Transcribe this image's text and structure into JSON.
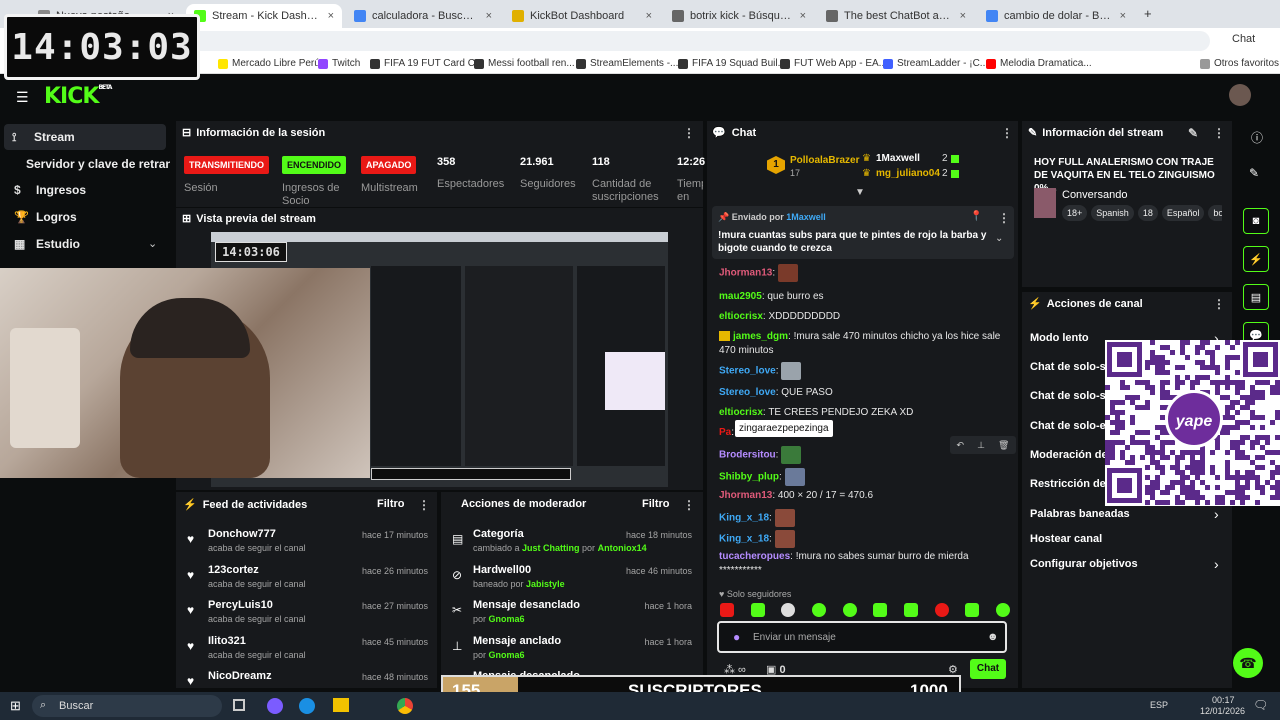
{
  "browser": {
    "tabs": [
      {
        "label": "Nueva pestaña",
        "color": "#888"
      },
      {
        "label": "Stream - Kick Dashboard",
        "color": "#53fc18"
      },
      {
        "label": "calculadora - Buscar con Google",
        "color": "#4285f4"
      },
      {
        "label": "KickBot Dashboard",
        "color": "#e0b000"
      },
      {
        "label": "botrix kick - Búsqueda",
        "color": "#666"
      },
      {
        "label": "The best ChatBot and Widgets fo",
        "color": "#666"
      },
      {
        "label": "cambio de dolar - Buscar con Goo",
        "color": "#4285f4"
      }
    ],
    "url": "stream",
    "chat_btn": "Chat",
    "bookmarks": [
      {
        "label": "Mercado Libre Perú",
        "color": "#ffe600"
      },
      {
        "label": "Twitch",
        "color": "#9146ff"
      },
      {
        "label": "FIFA 19 FUT Card C...",
        "color": "#333"
      },
      {
        "label": "Messi football ren...",
        "color": "#333"
      },
      {
        "label": "StreamElements -...",
        "color": "#333"
      },
      {
        "label": "FIFA 19 Squad Buil...",
        "color": "#333"
      },
      {
        "label": "FUT Web App - EA...",
        "color": "#333"
      },
      {
        "label": "StreamLadder - ¡C...",
        "color": "#4060ff"
      },
      {
        "label": "Melodia Dramatica...",
        "color": "#ff0000"
      }
    ],
    "other_favs": "Otros favoritos"
  },
  "clock": "14:03:03",
  "sidebar": {
    "items": [
      {
        "label": "Stream",
        "icon": "broadcast-icon"
      },
      {
        "label": "Servidor y clave de retransmisión",
        "icon": ""
      },
      {
        "label": "Ingresos",
        "icon": "money-icon"
      },
      {
        "label": "Logros",
        "icon": "trophy-icon"
      },
      {
        "label": "Estudio",
        "icon": "studio-icon"
      }
    ]
  },
  "session": {
    "title": "Información de la sesión",
    "status": [
      {
        "badge": "TRANSMITIENDO",
        "label": "Sesión",
        "color": "#e91916"
      },
      {
        "badge": "ENCENDIDO",
        "label": "Ingresos de Socio",
        "color": "#53fc18"
      },
      {
        "badge": "APAGADO",
        "label": "Multistream",
        "color": "#e91916"
      }
    ],
    "stats": [
      {
        "value": "358",
        "label": "Espectadores"
      },
      {
        "value": "21.961",
        "label": "Seguidores"
      },
      {
        "value": "118",
        "label": "Cantidad de suscripciones"
      },
      {
        "value": "12:26",
        "label": "Tiempo en vivo"
      }
    ]
  },
  "preview": {
    "title": "Vista previa del stream",
    "clock": "14:03:06"
  },
  "feed": {
    "title": "Feed de actividades",
    "filter": "Filtro",
    "items": [
      {
        "name": "Donchow777",
        "action": "acaba de seguir el canal",
        "time": "hace 17 minutos"
      },
      {
        "name": "123cortez",
        "action": "acaba de seguir el canal",
        "time": "hace 26 minutos"
      },
      {
        "name": "PercyLuis10",
        "action": "acaba de seguir el canal",
        "time": "hace 27 minutos"
      },
      {
        "name": "Ilito321",
        "action": "acaba de seguir el canal",
        "time": "hace 45 minutos"
      },
      {
        "name": "NicoDreamz",
        "action": "",
        "time": "hace 48 minutos"
      }
    ]
  },
  "modactions": {
    "title": "Acciones de moderador",
    "filter": "Filtro",
    "items": [
      {
        "title": "Categoría",
        "pre": "cambiado a",
        "hl": "Just Chatting",
        "mid": "por",
        "by": "Antoniox14",
        "time": "hace 18 minutos",
        "icon": "category-icon"
      },
      {
        "title": "Hardwell00",
        "pre": "baneado por",
        "hl": "",
        "mid": "",
        "by": "Jabistyle",
        "time": "hace 46 minutos",
        "icon": "ban-icon"
      },
      {
        "title": "Mensaje desanclado",
        "pre": "por",
        "hl": "",
        "mid": "",
        "by": "Gnoma6",
        "time": "hace 1 hora",
        "icon": "unpin-icon"
      },
      {
        "title": "Mensaje anclado",
        "pre": "por",
        "hl": "",
        "mid": "",
        "by": "Gnoma6",
        "time": "hace 1 hora",
        "icon": "pin-icon"
      },
      {
        "title": "Mensaje desanclado",
        "pre": "",
        "hl": "",
        "mid": "",
        "by": "",
        "time": "",
        "icon": "unpin-icon"
      }
    ]
  },
  "chat": {
    "title": "Chat",
    "top_gifter": {
      "rank": "1",
      "name": "PolloalaBrazer",
      "count": "17"
    },
    "gifters": [
      {
        "name": "1Maxwell",
        "count": "2",
        "color": "#ffffff"
      },
      {
        "name": "mg_juliano04",
        "count": "2",
        "color": "#e6b800"
      }
    ],
    "pinned": {
      "by_label": "Enviado por",
      "by": "1Maxwell",
      "text": "!mura cuantas subs para que te pintes de rojo la barba y bigote cuando te crezca"
    },
    "messages": [
      {
        "user": "Jhorman13",
        "color": "#e05a7a",
        "text": "",
        "emote": "#7a3a2a"
      },
      {
        "user": "mau2905",
        "color": "#53fc18",
        "text": "que burro es",
        "emote": ""
      },
      {
        "user": "eltiocrisx",
        "color": "#53fc18",
        "text": "XDDDDDDDDD",
        "emote": ""
      },
      {
        "user": "james_dgm",
        "color": "#53fc18",
        "text": "!mura sale 470 minutos chicho ya los hice sale 470 minutos",
        "emote": ""
      },
      {
        "user": "Stereo_love",
        "color": "#3fa9f5",
        "text": "",
        "emote": "#9aa3ab"
      },
      {
        "user": "Stereo_love",
        "color": "#3fa9f5",
        "text": "QUE PASO",
        "emote": ""
      },
      {
        "user": "eltiocrisx",
        "color": "#53fc18",
        "text": "TE CREES PENDEJO ZEKA XD",
        "emote": ""
      },
      {
        "user": "Pa",
        "color": "#e91916",
        "text": "umas?",
        "emote": ""
      },
      {
        "user": "Brodersitou",
        "color": "#b58cff",
        "text": "",
        "emote": "#3a7a3a"
      },
      {
        "user": "Shibby_plup",
        "color": "#53fc18",
        "text": "",
        "emote": "#6a7a9a"
      },
      {
        "user": "Jhorman13",
        "color": "#e05a7a",
        "text": "400 × 20 / 17 = 470.6",
        "emote": ""
      },
      {
        "user": "King_x_18",
        "color": "#3fa9f5",
        "text": "",
        "emote": "#8a4a3a"
      },
      {
        "user": "King_x_18",
        "color": "#3fa9f5",
        "text": "",
        "emote": "#8a4a3a"
      },
      {
        "user": "tucacheropues",
        "color": "#b58cff",
        "text": "!mura no sabes sumar burro de mierda ***********",
        "emote": ""
      }
    ],
    "tooltip": "zingaraezpepezinga",
    "followers_only": "Solo seguidores",
    "placeholder": "Enviar un mensaje",
    "points": "0",
    "send": "Chat"
  },
  "streaminfo": {
    "title": "Información del stream",
    "stream_title": "HOY FULL ANALERISMO CON TRAJE DE VAQUITA EN EL TELO ZINGUISMO 0%...",
    "category": "Conversando",
    "tags": [
      "18+",
      "Spanish",
      "18",
      "Español",
      "bo"
    ]
  },
  "channel": {
    "title": "Acciones de canal",
    "items": [
      "Modo lento",
      "Chat de solo-seg",
      "Chat de solo-sus",
      "Chat de solo-em",
      "Moderación del c",
      "Restricción de e",
      "Palabras baneadas",
      "Hostear canal",
      "Configurar objetivos"
    ]
  },
  "subs_bar": {
    "current": "155",
    "label": "SUSCRIPTORES",
    "goal": "1000",
    "progress": 0.155
  },
  "qr": {
    "brand": "yape"
  },
  "taskbar": {
    "search": "Buscar",
    "lang": "ESP",
    "time": "00:17",
    "date": "12/01/2026"
  }
}
